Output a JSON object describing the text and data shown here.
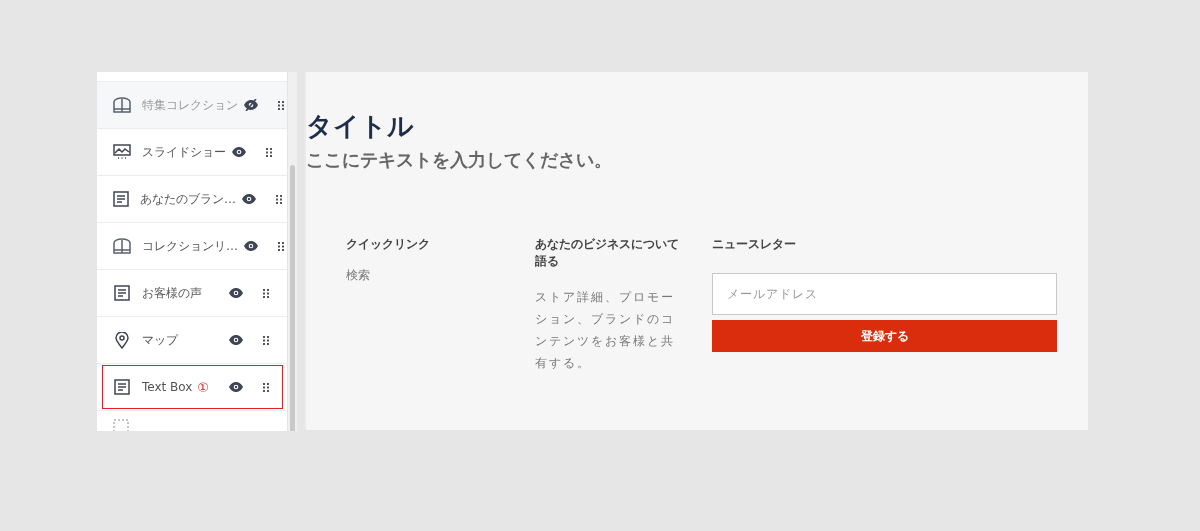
{
  "sidebar": {
    "items": [
      {
        "kind": "collection",
        "label": "特集コレクション",
        "visible": false,
        "highlighted": false
      },
      {
        "kind": "slideshow",
        "label": "スライドショー",
        "visible": true,
        "highlighted": false
      },
      {
        "kind": "text",
        "label": "あなたのブラン…",
        "visible": true,
        "highlighted": false
      },
      {
        "kind": "collection",
        "label": "コレクションリ…",
        "visible": true,
        "highlighted": false
      },
      {
        "kind": "text",
        "label": "お客様の声",
        "visible": true,
        "highlighted": false
      },
      {
        "kind": "map",
        "label": "マップ",
        "visible": true,
        "highlighted": false
      },
      {
        "kind": "text",
        "label": "Text Box",
        "visible": true,
        "highlighted": true,
        "badge": "①"
      }
    ]
  },
  "preview": {
    "title": "タイトル",
    "subtitle": "ここにテキストを入力してください。",
    "footer": {
      "columns": [
        {
          "heading": "クイックリンク",
          "links": [
            "検索"
          ]
        },
        {
          "heading": "あなたのビジネスについて語る",
          "text": "ストア詳細、プロモーション、ブランドのコンテンツをお客様と共有する。"
        }
      ],
      "newsletter": {
        "heading": "ニュースレター",
        "placeholder": "メールアドレス",
        "button": "登録する"
      }
    }
  }
}
